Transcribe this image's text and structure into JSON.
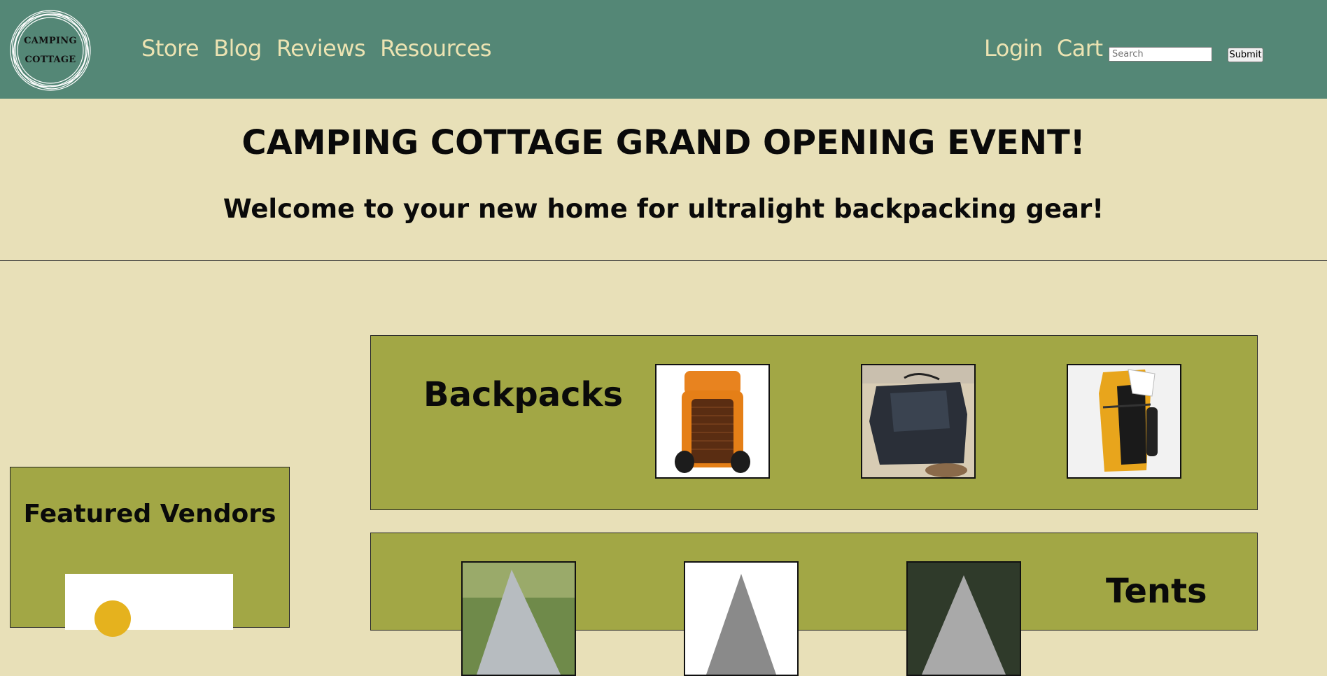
{
  "logo": {
    "line1": "CAMPING",
    "line2": "COTTAGE"
  },
  "nav": [
    {
      "label": "Store"
    },
    {
      "label": "Blog"
    },
    {
      "label": "Reviews"
    },
    {
      "label": "Resources"
    }
  ],
  "account": {
    "login_label": "Login",
    "cart_label": "Cart"
  },
  "search": {
    "placeholder": "Search",
    "value": "",
    "submit_label": "Submit"
  },
  "hero": {
    "title": "CAMPING COTTAGE GRAND OPENING EVENT!",
    "subtitle": "Welcome to your new home for ultralight backpacking gear!"
  },
  "vendors": {
    "title": "Featured Vendors"
  },
  "categories": [
    {
      "title": "Backpacks"
    },
    {
      "title": "Tents"
    }
  ],
  "colors": {
    "header": "#548776",
    "page_background": "#e8e0b8",
    "panel": "#a2a745",
    "nav_text": "#ece3b2"
  }
}
